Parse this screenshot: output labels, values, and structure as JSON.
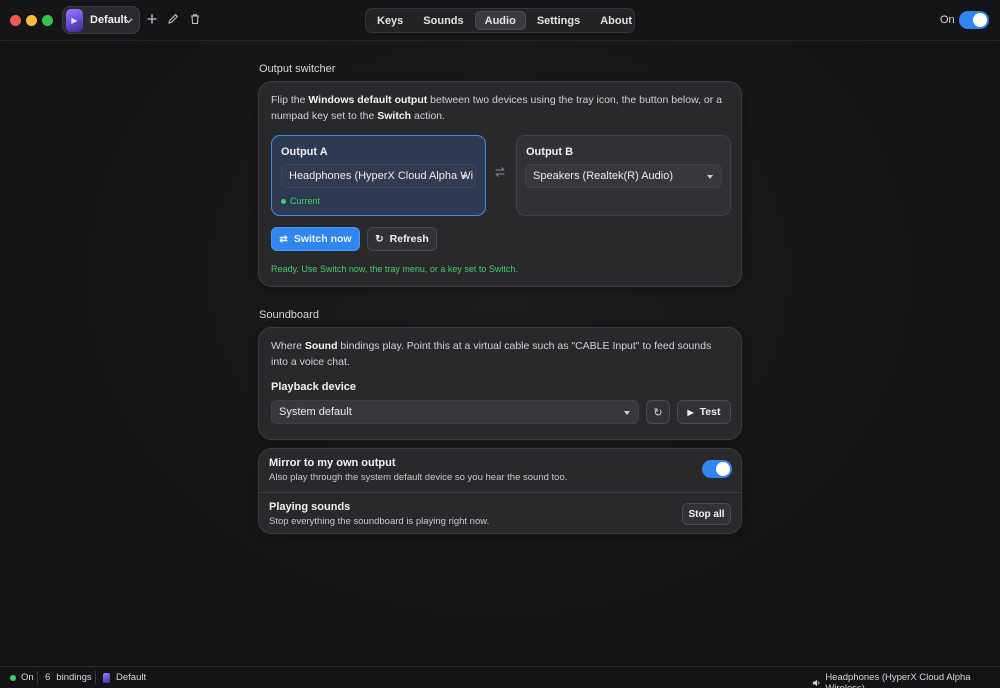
{
  "titlebar": {
    "profile_name": "Default",
    "tabs": [
      {
        "label": "Keys"
      },
      {
        "label": "Sounds"
      },
      {
        "label": "Audio"
      },
      {
        "label": "Settings"
      },
      {
        "label": "About"
      }
    ],
    "active_tab": "Audio",
    "power_label": "On",
    "power_on": true
  },
  "output_switcher": {
    "section_title": "Output switcher",
    "desc_pre": "Flip the ",
    "desc_bold1": "Windows default output",
    "desc_mid": " between two devices using the tray icon, the button below, or a numpad key set to the ",
    "desc_bold2": "Switch",
    "desc_post": " action.",
    "output_a": {
      "label": "Output A",
      "device": "Headphones (HyperX Cloud Alpha Wi",
      "current_label": "Current"
    },
    "output_b": {
      "label": "Output B",
      "device": "Speakers (Realtek(R) Audio)"
    },
    "switch_button": "Switch now",
    "refresh_button": "Refresh",
    "status_text": "Ready. Use Switch now, the tray menu, or a key set to Switch."
  },
  "soundboard": {
    "section_title": "Soundboard",
    "desc_pre": "Where ",
    "desc_bold": "Sound",
    "desc_post": " bindings play. Point this at a virtual cable such as \"CABLE Input\" to feed sounds into a voice chat.",
    "playback_label": "Playback device",
    "playback_value": "System default",
    "test_button": "Test",
    "mirror": {
      "title": "Mirror to my own output",
      "subtitle": "Also play through the system default device so you hear the sound too.",
      "enabled": true
    },
    "playing": {
      "title": "Playing sounds",
      "subtitle": "Stop everything the soundboard is playing right now.",
      "button": "Stop all"
    }
  },
  "statusbar": {
    "state": "On",
    "bindings_count": "6",
    "bindings_label": "bindings",
    "profile": "Default",
    "output_device": "Headphones (HyperX Cloud Alpha Wireless)"
  },
  "colors": {
    "accent": "#2f86f0",
    "success": "#3fcf6a"
  },
  "icons": [
    "plus-icon",
    "pencil-icon",
    "trash-icon",
    "swap-icon",
    "refresh-icon",
    "play-icon",
    "speaker-icon",
    "chevron-down-icon"
  ]
}
